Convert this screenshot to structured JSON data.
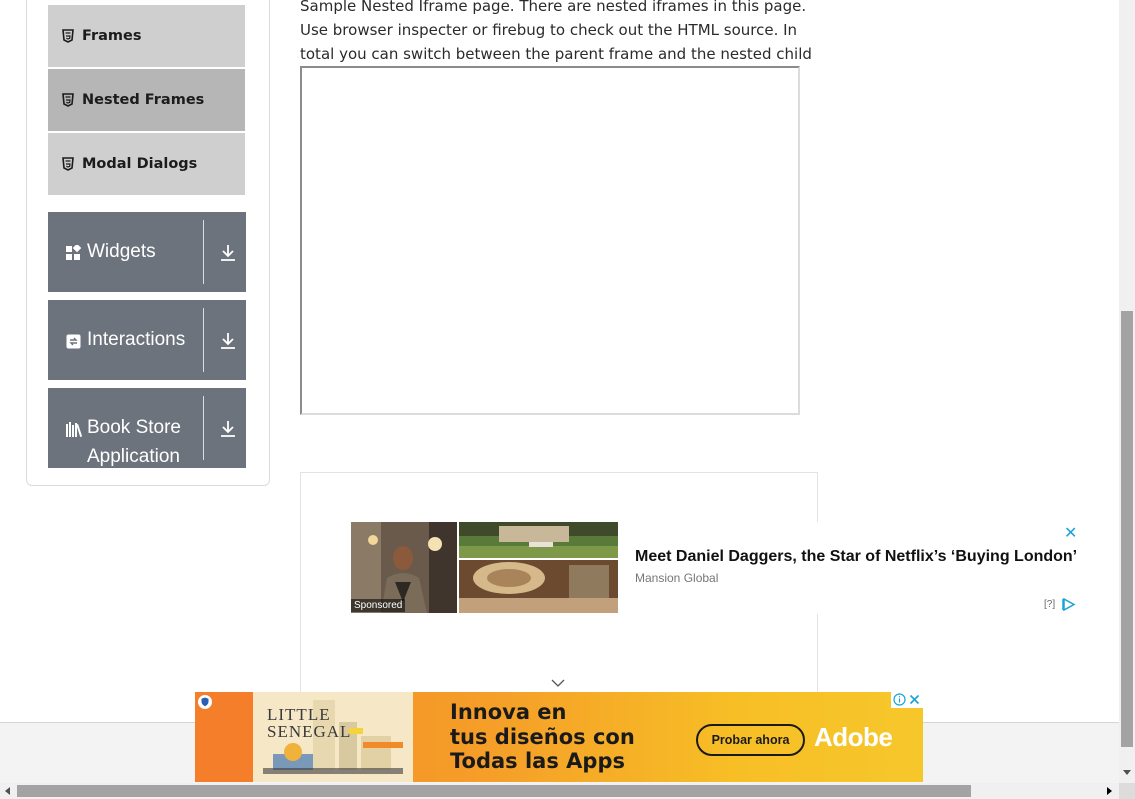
{
  "sidebar": {
    "sub_items": [
      {
        "label": "Frames",
        "icon": "html5-icon",
        "active": false
      },
      {
        "label": "Nested Frames",
        "icon": "html5-icon",
        "active": true
      },
      {
        "label": "Modal Dialogs",
        "icon": "html5-icon",
        "active": false
      }
    ],
    "groups": [
      {
        "label": "Widgets",
        "icon": "widgets-icon",
        "arrow": "download-arrow-icon"
      },
      {
        "label": "Interactions",
        "icon": "interactions-icon",
        "arrow": "download-arrow-icon"
      },
      {
        "label_line1": "Book Store",
        "label_line2": "Application",
        "icon": "books-icon",
        "arrow": "download-arrow-icon"
      }
    ]
  },
  "main": {
    "intro_text": "Sample Nested Iframe page. There are nested iframes in this page. Use browser inspecter or firebug to check out the HTML source. In total you can switch between the parent frame and the nested child frame."
  },
  "native_ad": {
    "sponsored": "Sponsored",
    "title": "Meet Daniel Daggers, the Star of Netflix’s ‘Buying London’",
    "source": "Mansion Global",
    "close": "✕",
    "help": "[?]"
  },
  "banner_ad": {
    "art_text_line1": "LITTLE",
    "art_text_line2": "SENEGAL",
    "headline_line1": "Innova en",
    "headline_line2": "tus diseños con",
    "headline_line3": "Todas las Apps",
    "cta": "Probar ahora",
    "brand": "Adobe"
  },
  "colors": {
    "sidebar_group_bg": "#6c737c",
    "sidebar_sub_bg": "#cfcfcf",
    "sidebar_sub_active_bg": "#b6b6b6",
    "native_close": "#1aa3d9",
    "banner_orange": "#f58a2b",
    "banner_yellow": "#f6c72b"
  }
}
